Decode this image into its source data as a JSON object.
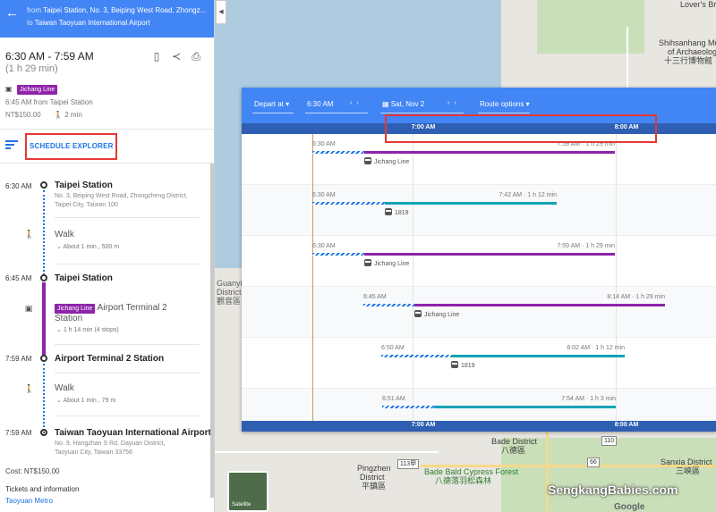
{
  "header": {
    "from_prefix": "from",
    "from": "Taipei Station, No. 3, Beiping West Road, Zhongz...",
    "to_prefix": "to",
    "to": "Taiwan Taoyuan International Airport"
  },
  "summary": {
    "time_range": "6:30 AM - 7:59 AM",
    "duration": "(1 h 29 min)",
    "line_badge": "Jichang Line",
    "depart_info": "6:45 AM from Taipei Station",
    "fare": "NT$150.00",
    "walk": "2 min"
  },
  "schedule_explorer_label": "SCHEDULE EXPLORER",
  "steps": {
    "s1": {
      "time": "6:30 AM",
      "stop": "Taipei Station",
      "address": "No. 3, Beiping West Road, Zhongzheng District, Taipei City, Taiwan 100"
    },
    "walk1": {
      "label": "Walk",
      "detail": "About 1 min , 500 m"
    },
    "s2": {
      "time": "6:45 AM",
      "stop": "Taipei Station"
    },
    "transit": {
      "badge": "Jichang Line",
      "dest": "Airport Terminal 2 Station",
      "detail": "1 h 14 min (4 stops)"
    },
    "s3": {
      "time": "7:59 AM",
      "stop": "Airport Terminal 2 Station"
    },
    "walk2": {
      "label": "Walk",
      "detail": "About 1 min , 79 m"
    },
    "s4": {
      "time": "7:59 AM",
      "stop": "Taiwan Taoyuan International Airport",
      "address": "No. 9, Hangzhan S Rd, Dayuan District, Taoyuan City, Taiwan 33758"
    },
    "cost": "Cost: NT$150.00",
    "tickets": "Tickets and information",
    "tickets_link": "Taoyuan Metro"
  },
  "explorer": {
    "toolbar": {
      "depart_mode": "Depart at",
      "time": "6:30 AM",
      "date": "Sat, Nov 2",
      "route_options": "Route options"
    },
    "axis": {
      "label_a": "7:00 AM",
      "label_b": "8:00 AM"
    },
    "trips": [
      {
        "depart": "6:30 AM",
        "arrive": "7:59 AM · 1 h 29 min",
        "line": "Jichang Line",
        "color": "#8e24aa",
        "mode": "rail"
      },
      {
        "depart": "6:30 AM",
        "arrive": "7:42 AM · 1 h 12 min",
        "line": "1819",
        "color": "#13a2b5",
        "mode": "bus"
      },
      {
        "depart": "6:30 AM",
        "arrive": "7:59 AM · 1 h 29 min",
        "line": "Jichang Line",
        "color": "#8e24aa",
        "mode": "rail"
      },
      {
        "depart": "6:45 AM",
        "arrive": "8:14 AM · 1 h 29 min",
        "line": "Jichang Line",
        "color": "#8e24aa",
        "mode": "rail"
      },
      {
        "depart": "6:50 AM",
        "arrive": "8:02 AM · 1 h 12 min",
        "line": "1819",
        "color": "#13a2b5",
        "mode": "bus"
      },
      {
        "depart": "6:51 AM",
        "arrive": "7:54 AM · 1 h 3 min",
        "line": "",
        "color": "#13a2b5",
        "mode": "bus"
      }
    ]
  },
  "map_labels": {
    "lovers_bridge": "Lover's Bridg",
    "museum_1": "Shihsanhang Muse",
    "museum_2": "of Archaeolog",
    "museum_3": "十三行博物館",
    "guanyin_1": "Guanyin",
    "guanyin_2": "District",
    "guanyin_3": "觀音區",
    "bade_1": "Bade District",
    "bade_2": "八德區",
    "sanxia_1": "Sanxia District",
    "sanxia_2": "三峡區",
    "pingzhen_1": "Pingzhen",
    "pingzhen_2": "District",
    "pingzhen_3": "平鎮區",
    "cypress_1": "Bade Bald Cypress Forest",
    "cypress_2": "八德落羽松森林",
    "shield_1": "113甲",
    "shield_2": "110",
    "shield_3": "66",
    "satellite": "Satellite",
    "watermark": "SengkangBabies.com",
    "google": "Google"
  }
}
